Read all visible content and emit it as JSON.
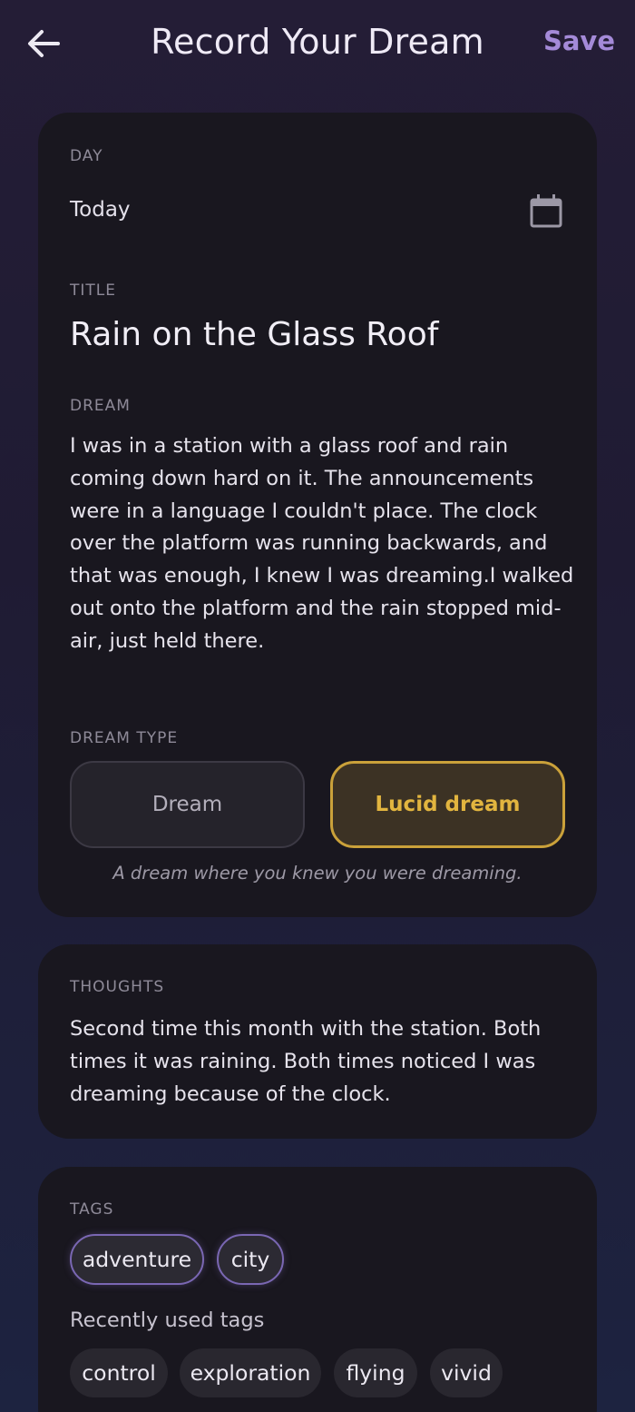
{
  "header": {
    "title": "Record Your Dream",
    "save_label": "Save",
    "back_icon": "arrow-left-icon"
  },
  "entry": {
    "day_label": "DAY",
    "day_value": "Today",
    "calendar_icon": "calendar-icon",
    "title_label": "TITLE",
    "title_value": "Rain on the Glass Roof",
    "dream_label": "DREAM",
    "dream_text": "I was in a station with a glass roof and rain coming down hard on it. The announcements were in a language I couldn't place. The clock over the platform was running backwards, and that was enough, I knew I was dreaming.I walked out onto the platform and the rain stopped mid-air, just held there.",
    "type_label": "DREAM TYPE",
    "type_options": [
      "Dream",
      "Lucid dream"
    ],
    "type_selected": "Lucid dream",
    "type_description": "A dream where you knew you were dreaming."
  },
  "thoughts": {
    "label": "THOUGHTS",
    "text": "Second time this month with the station. Both times it was raining. Both times noticed I was dreaming because of the clock."
  },
  "tags": {
    "label": "TAGS",
    "selected": [
      "adventure",
      "city"
    ],
    "recent_label": "Recently used tags",
    "recent": [
      "control",
      "exploration",
      "flying",
      "vivid"
    ]
  },
  "colors": {
    "accent": "#a48ad8",
    "lucid_gold": "#caa13a",
    "card_bg": "#19171f"
  }
}
